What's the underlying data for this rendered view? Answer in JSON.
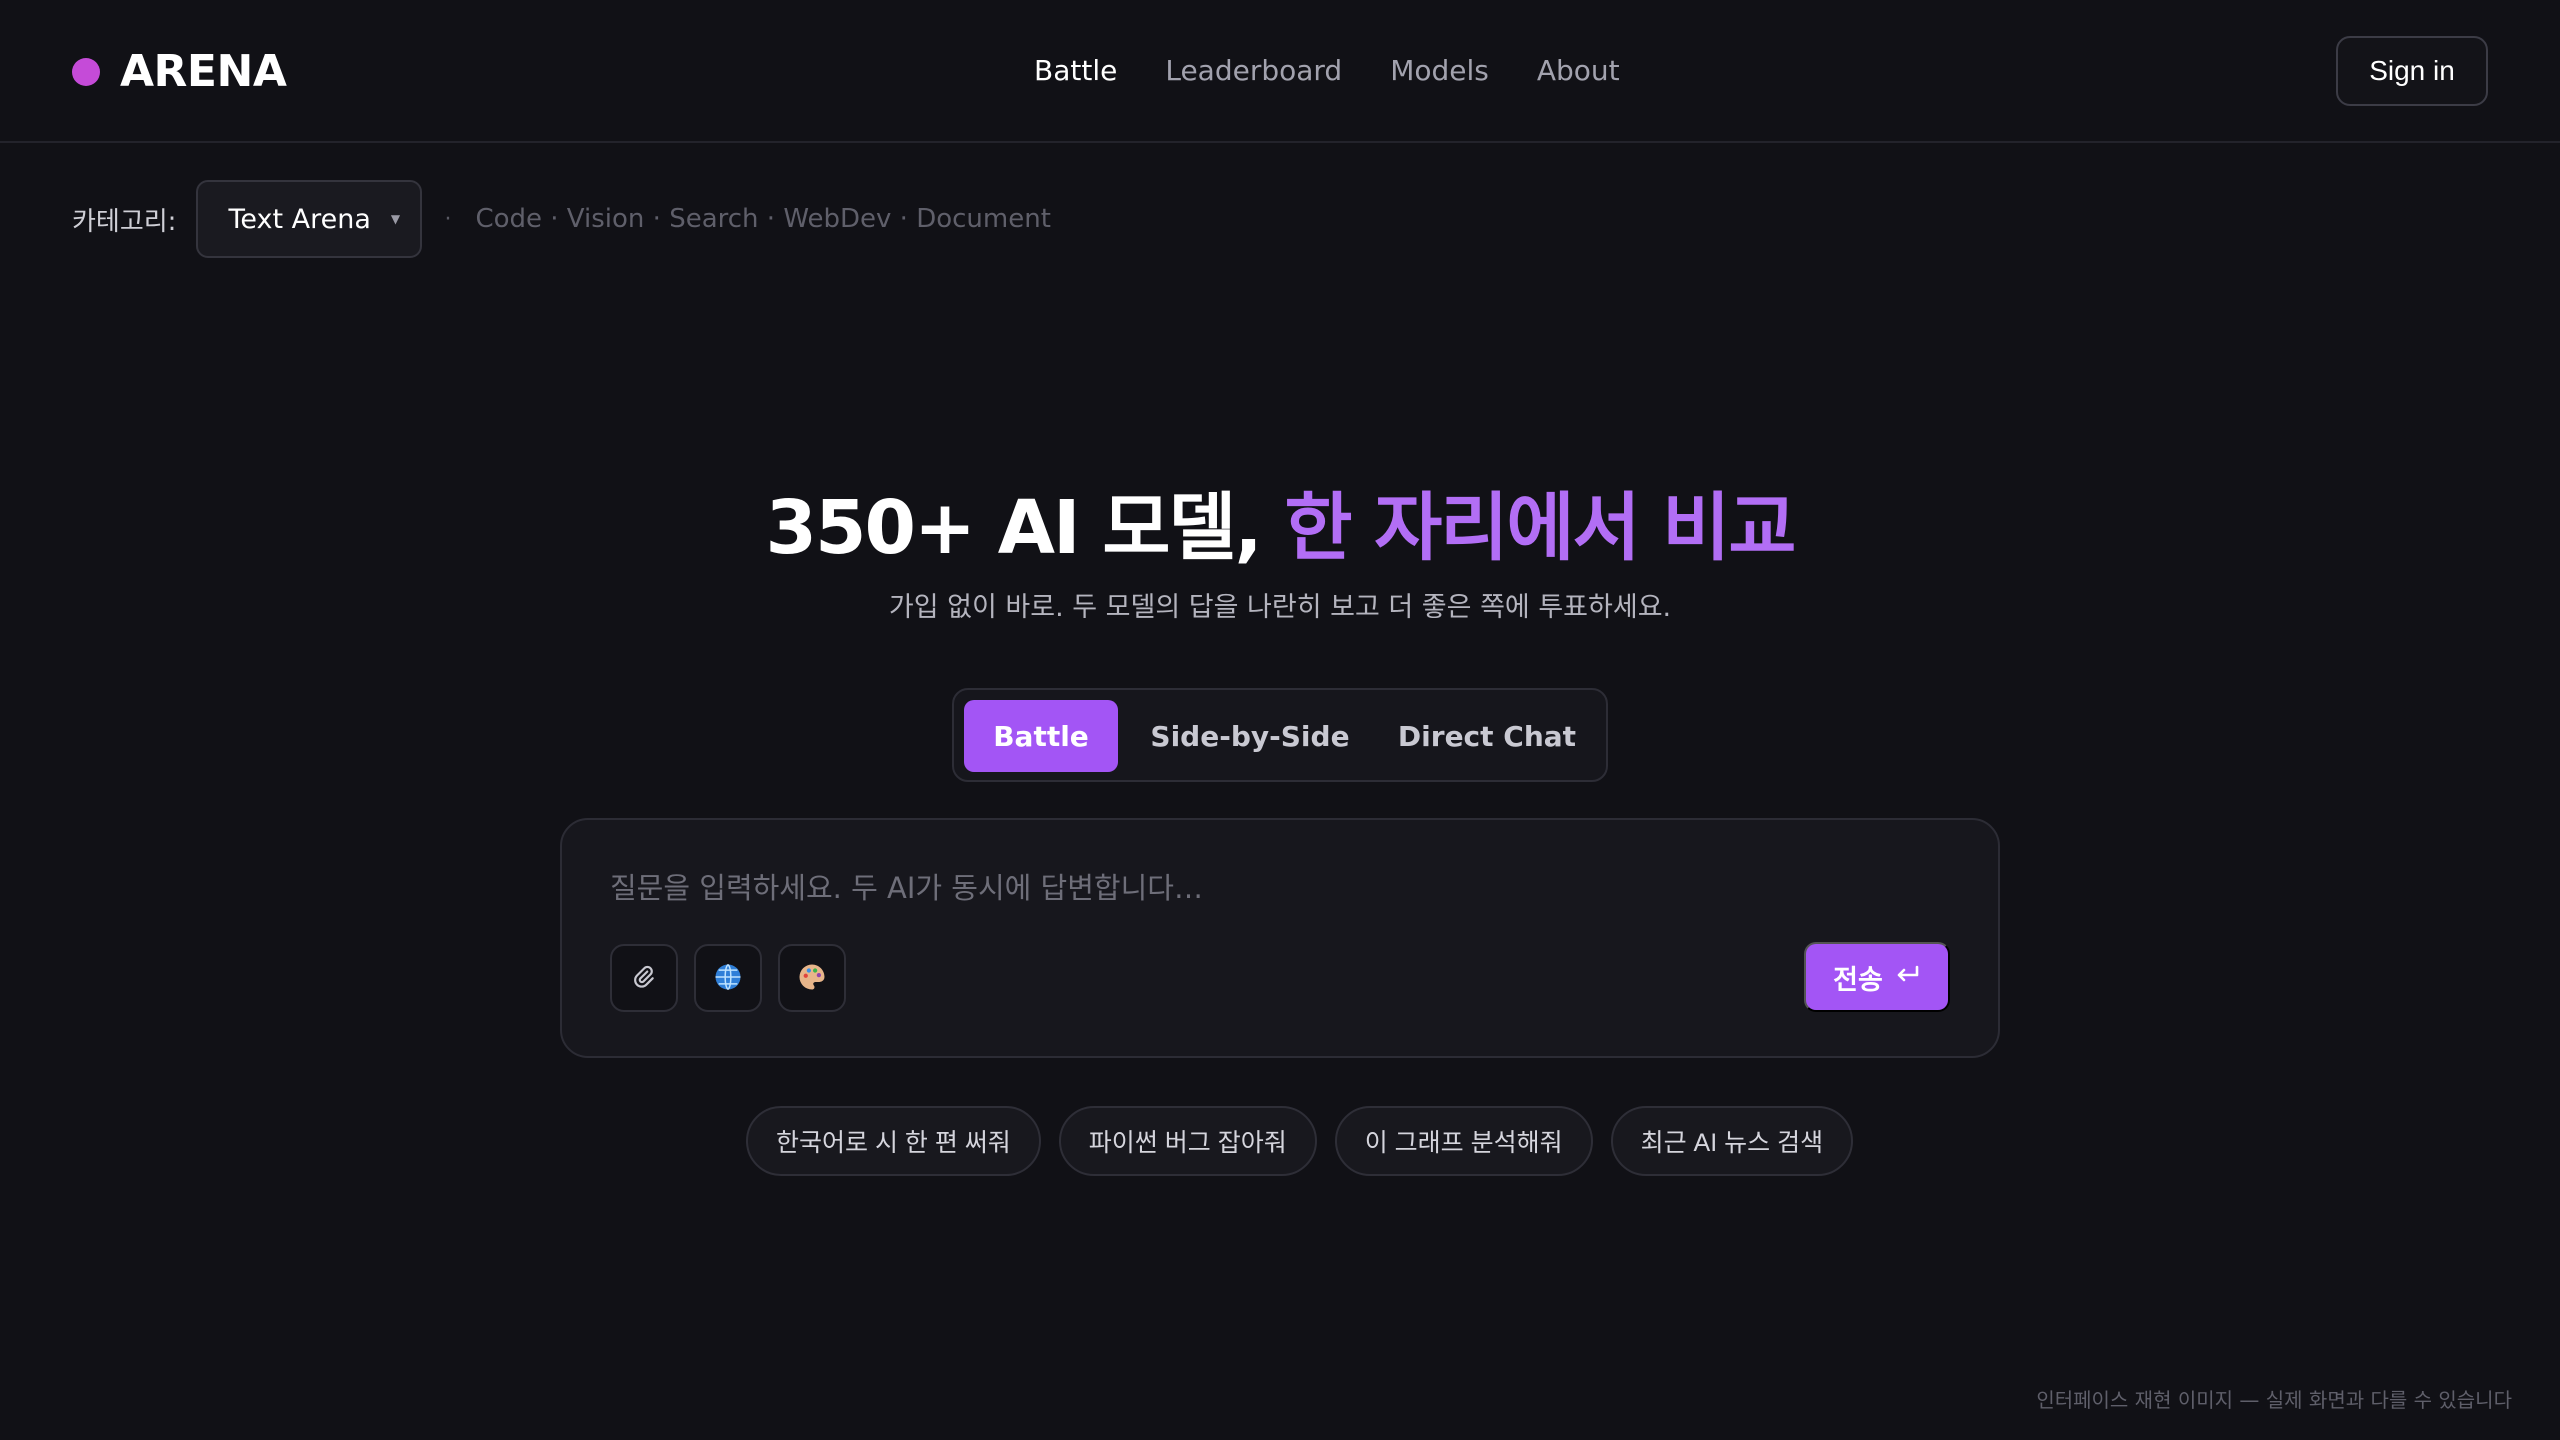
{
  "brand": {
    "name": "ARENA",
    "dot_color": "#c54bd8"
  },
  "nav": {
    "items": [
      {
        "label": "Battle",
        "active": true
      },
      {
        "label": "Leaderboard",
        "active": false
      },
      {
        "label": "Models",
        "active": false
      },
      {
        "label": "About",
        "active": false
      }
    ],
    "signin_label": "Sign in"
  },
  "category": {
    "label": "카테고리:",
    "selected": "Text Arena",
    "others": "Code · Vision · Search · WebDev · Document"
  },
  "hero": {
    "title_white": "350+ AI 모델,",
    "title_purple": "한 자리에서 비교",
    "subtitle": "가입 없이 바로. 두 모델의 답을 나란히 보고 더 좋은 쪽에 투표하세요."
  },
  "modes": [
    {
      "label": "Battle",
      "active": true
    },
    {
      "label": "Side-by-Side",
      "active": false
    },
    {
      "label": "Direct Chat",
      "active": false
    }
  ],
  "composer": {
    "placeholder": "질문을 입력하세요. 두 AI가 동시에 답변합니다…",
    "value": "",
    "tools": [
      "paperclip-icon",
      "globe-icon",
      "palette-icon"
    ],
    "send_label": "전송"
  },
  "suggestions": [
    "한국어로 시 한 편 써줘",
    "파이썬 버그 잡아줘",
    "이 그래프 분석해줘",
    "최근 AI 뉴스 검색"
  ],
  "footer_note": "인터페이스 재현 이미지 — 실제 화면과 다를 수 있습니다",
  "colors": {
    "accent": "#a355f5",
    "accent_text": "#b26ef5",
    "background": "#111116"
  }
}
